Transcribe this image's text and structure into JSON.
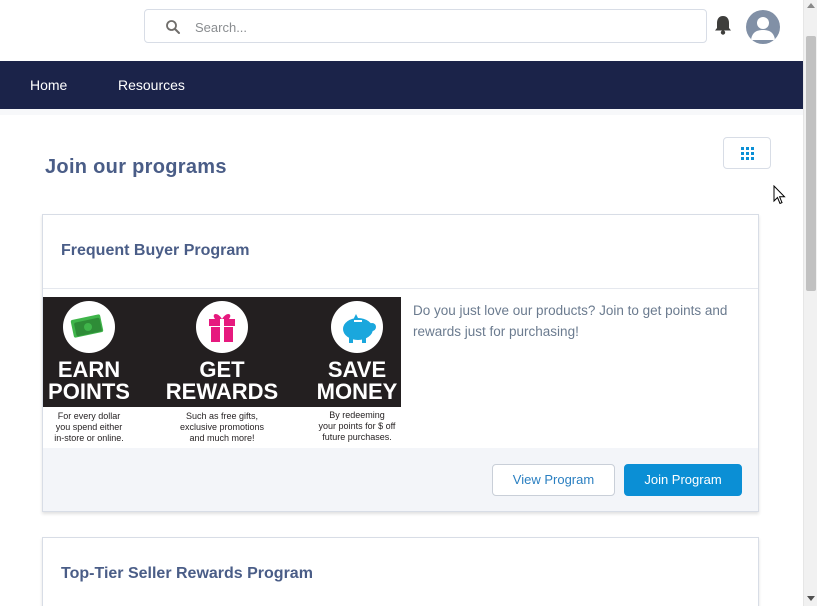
{
  "header": {
    "search_placeholder": "Search...",
    "search_value": ""
  },
  "nav": {
    "items": [
      {
        "label": "Home"
      },
      {
        "label": "Resources"
      }
    ]
  },
  "main": {
    "title": "Join our programs",
    "programs": [
      {
        "title": "Frequent Buyer Program",
        "description": "Do you just love our products? Join to get points and rewards just for purchasing!",
        "view_label": "View Program",
        "join_label": "Join Program",
        "promo": {
          "panels": [
            {
              "heading_line1": "EARN",
              "heading_line2": "POINTS",
              "caption": [
                "For every dollar",
                "you spend either",
                "in-store or online."
              ],
              "icon": "money-icon",
              "icon_color": "#3fb54a"
            },
            {
              "heading_line1": "GET",
              "heading_line2": "REWARDS",
              "caption": [
                "Such as free gifts,",
                "exclusive promotions",
                "and much more!"
              ],
              "icon": "gift-icon",
              "icon_color": "#e6197e"
            },
            {
              "heading_line1": "SAVE",
              "heading_line2": "MONEY",
              "caption": [
                "By redeeming",
                "your points for $ off",
                "future purchases."
              ],
              "icon": "piggy-bank-icon",
              "icon_color": "#1aa7dd"
            }
          ]
        }
      },
      {
        "title": "Top-Tier Seller Rewards Program"
      }
    ]
  },
  "colors": {
    "navbar": "#1b2349",
    "title": "#4a5d87",
    "primary_button": "#0b8fd5"
  }
}
